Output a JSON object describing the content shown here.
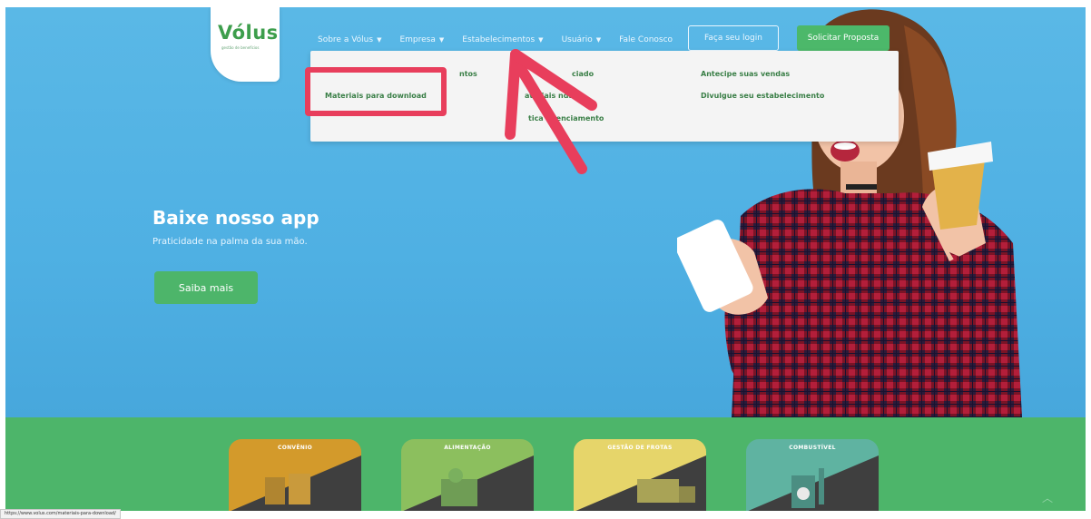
{
  "header": {
    "logo_text": "Vólus",
    "logo_subtitle": "gestão de benefícios",
    "nav": [
      {
        "label": "Sobre a Vólus"
      },
      {
        "label": "Empresa"
      },
      {
        "label": "Estabelecimentos"
      },
      {
        "label": "Usuário"
      },
      {
        "label": "Fale Conosco"
      }
    ],
    "login_label": "Faça seu login",
    "proposal_label": "Solicitar Proposta"
  },
  "dropdown": {
    "col1": [
      "ntos",
      "Materiais para download"
    ],
    "col2": [
      "ciado",
      "ateriais   ndas",
      "tica   edenciamento"
    ],
    "col3": [
      "Antecipe suas vendas",
      "Divulgue seu estabelecimento"
    ]
  },
  "hero": {
    "title": "Baixe nosso app",
    "subtitle": "Praticidade na palma da sua mão.",
    "cta_label": "Saiba mais"
  },
  "categories": [
    {
      "label": "CONVÊNIO",
      "color": "#d39a2b"
    },
    {
      "label": "ALIMENTAÇÃO",
      "color": "#8cbf5e"
    },
    {
      "label": "GESTÃO DE FROTAS",
      "color": "#e6d56a"
    },
    {
      "label": "COMBUSTÍVEL",
      "color": "#5fb3a1"
    }
  ],
  "annotation": {
    "color": "#e83e5c"
  },
  "status_bar": {
    "url": "https://www.volus.com/materiais-para-download/"
  }
}
